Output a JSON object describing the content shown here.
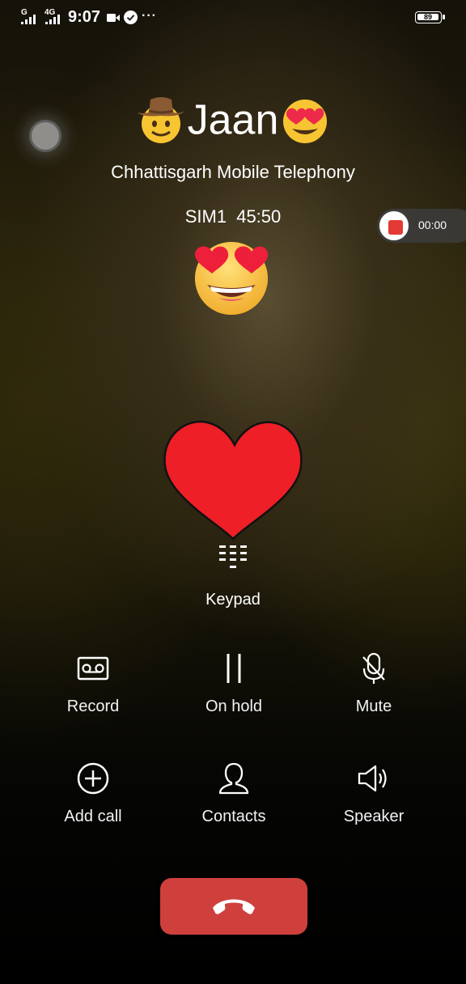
{
  "status_bar": {
    "network_label": "G",
    "network_label_2": "4G",
    "time": "9:07",
    "icons": [
      "signal-icon",
      "signal-icon",
      "video-icon",
      "check-circle-icon",
      "more-dots-icon"
    ],
    "more": "···",
    "battery": "89"
  },
  "call": {
    "name": "Jaan",
    "name_prefix_emoji": "cowboy-emoji-icon",
    "name_suffix_emoji": "heart-eyes-emoji-icon",
    "carrier": "Chhattisgarh Mobile Telephony",
    "sim": "SIM1",
    "duration": "45:50",
    "recording_time": "00:00"
  },
  "keypad": {
    "label": "Keypad"
  },
  "actions": [
    {
      "label": "Record",
      "icon": "record-icon"
    },
    {
      "label": "On hold",
      "icon": "pause-icon"
    },
    {
      "label": "Mute",
      "icon": "mic-off-icon"
    },
    {
      "label": "Add call",
      "icon": "add-circle-icon"
    },
    {
      "label": "Contacts",
      "icon": "person-icon"
    },
    {
      "label": "Speaker",
      "icon": "speaker-icon"
    }
  ],
  "end_call": {
    "icon": "hang-up-icon",
    "color": "#cf403d"
  },
  "colors": {
    "heart": "#ee1f26",
    "record_dot": "#e53935",
    "emoji": "#f7c531"
  }
}
